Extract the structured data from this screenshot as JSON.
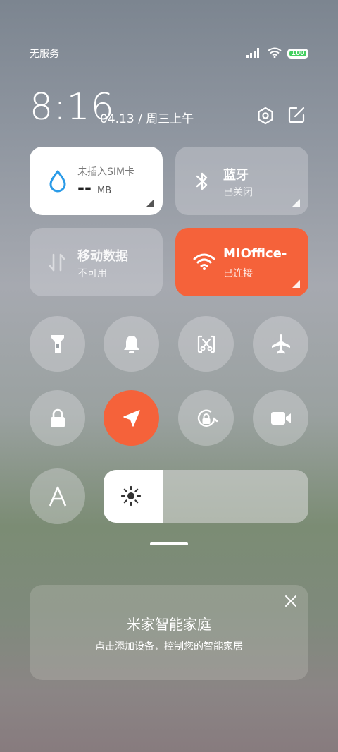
{
  "status": {
    "carrier": "无服务",
    "battery": "100"
  },
  "header": {
    "time": "8:16",
    "date": "04.13 / 周三上午"
  },
  "tiles": {
    "data": {
      "title": "未插入SIM卡",
      "value": "--",
      "unit": "MB"
    },
    "bluetooth": {
      "title": "蓝牙",
      "status": "已关闭"
    },
    "mobile": {
      "title": "移动数据",
      "status": "不可用"
    },
    "wifi": {
      "title": "MIOffice-",
      "status": "已连接"
    }
  },
  "brightness": {
    "level": 0.29
  },
  "card": {
    "title": "米家智能家庭",
    "subtitle": "点击添加设备，控制您的智能家居"
  },
  "colors": {
    "accent": "#f5623a",
    "water": "#2a9be8"
  }
}
